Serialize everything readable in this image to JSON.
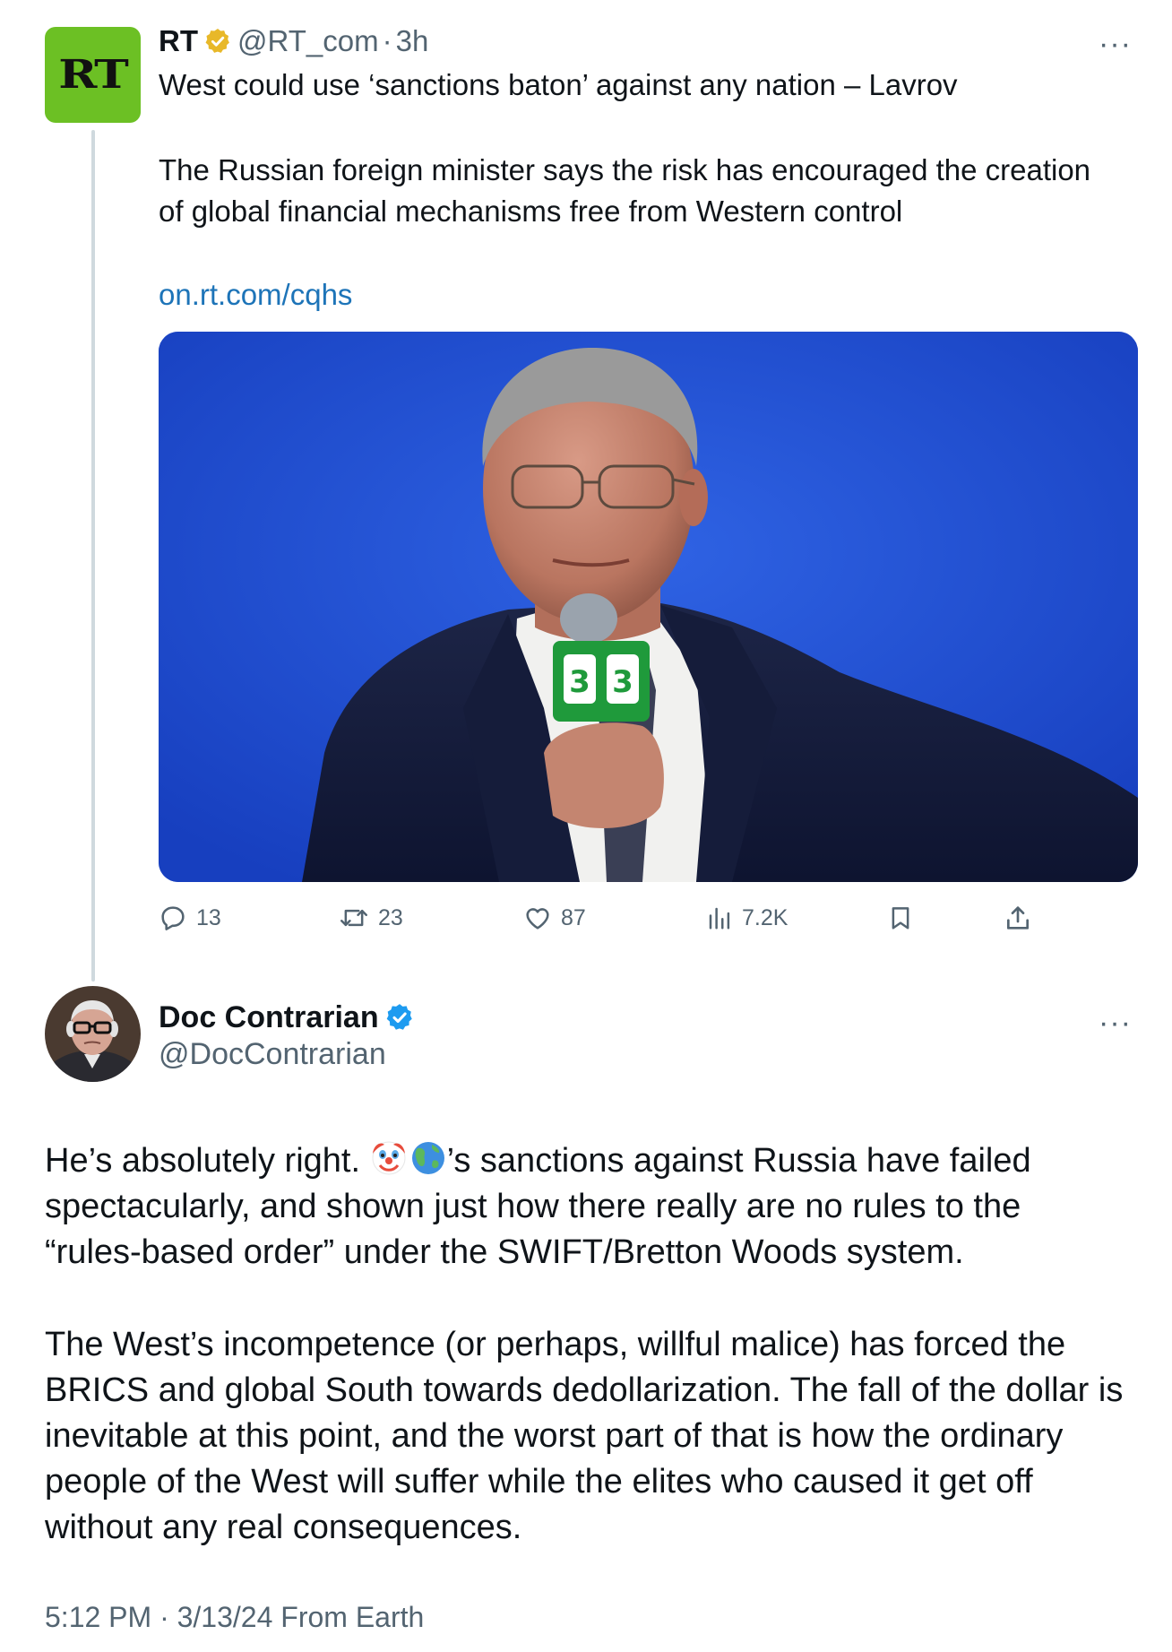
{
  "quoted_tweet": {
    "name": "RT",
    "avatar_text": "RT",
    "handle": "@RT_com",
    "separator": "·",
    "time": "3h",
    "headline": "West could use ‘sanctions baton’ against any nation – Lavrov",
    "summary_lines": [
      "The Russian foreign minister says the risk has encouraged the creation",
      "of global financial mechanisms free from Western control"
    ],
    "link": "on.rt.com/cqhs",
    "more_label": "···",
    "actions": {
      "replies": "13",
      "reposts": "23",
      "likes": "87",
      "views": "7.2K"
    },
    "icons": [
      "verified-gold-badge-icon",
      "reply-icon",
      "repost-icon",
      "like-icon",
      "views-icon",
      "bookmark-icon",
      "share-icon"
    ]
  },
  "main_tweet": {
    "name": "Doc Contrarian",
    "handle": "@DocContrarian",
    "more_label": "···",
    "paragraph1": {
      "line1_start": "He’s absolutely right. ",
      "line1_end": "’s sanctions against Russia have failed",
      "line2": "spectacularly, and shown just how there really are no rules to the",
      "line3": "“rules-based order” under the SWIFT/Bretton Woods system."
    },
    "paragraph2_lines": [
      "The West’s incompetence (or perhaps, willful malice) has forced the",
      "BRICS and global South towards dedollarization. The fall of the dollar is",
      "inevitable at this point, and the worst part of that is how the ordinary",
      "people of the West will suffer while the elites who caused it get off",
      "without any real consequences."
    ],
    "timestamp": "5:12 PM · 3/13/24 From Earth",
    "icons": [
      "verified-blue-badge-icon",
      "clown-emoji-icon",
      "globe-emoji-icon"
    ]
  },
  "colors": {
    "text": "#0f1419",
    "muted": "#536471",
    "link": "#1d74b8",
    "rt_green": "#6cc024",
    "verified_blue": "#1d9bf0",
    "verified_gold": "#e8b829",
    "photo_blue": "#1f4bd0"
  }
}
